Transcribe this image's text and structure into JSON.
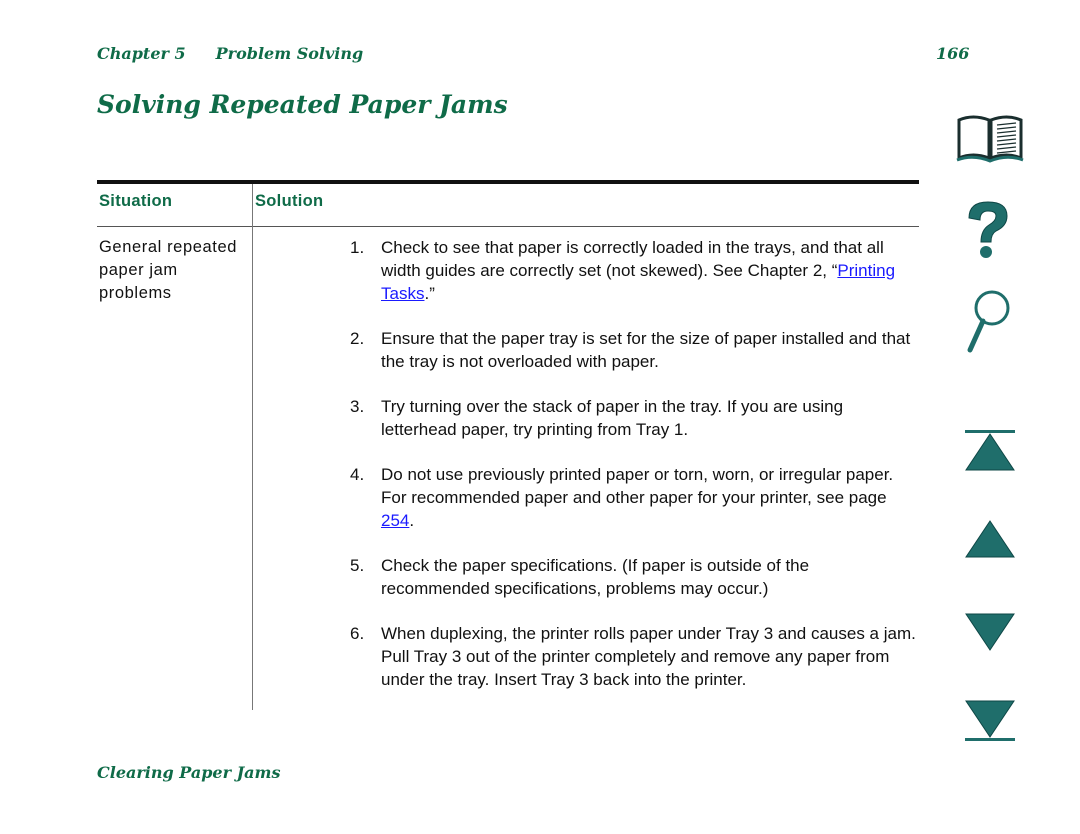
{
  "header": {
    "chapter": "Chapter 5",
    "section": "Problem Solving",
    "page_number": "166"
  },
  "title": "Solving Repeated Paper Jams",
  "table": {
    "columns": [
      "Situation",
      "Solution"
    ],
    "rows": [
      {
        "situation": "General repeated paper jam problems",
        "solutions": [
          {
            "num": "1.",
            "before": "Check to see that paper is correctly loaded in the trays, and that all width guides are correctly set (not skewed). See Chapter 2, “",
            "link": "Printing Tasks",
            "after": ".”"
          },
          {
            "num": "2.",
            "before": "Ensure that the paper tray is set for the size of paper installed and that the tray is not overloaded with paper.",
            "link": null,
            "after": ""
          },
          {
            "num": "3.",
            "before": "Try turning over the stack of paper in the tray. If you are using letterhead paper, try printing from Tray 1.",
            "link": null,
            "after": ""
          },
          {
            "num": "4.",
            "before": "Do not use previously printed paper or torn, worn, or irregular paper. For recommended paper and other paper for your printer, see page ",
            "link": "254",
            "after": "."
          },
          {
            "num": "5.",
            "before": "Check the paper specifications. (If paper is outside of the recommended specifications, problems may occur.)",
            "link": null,
            "after": ""
          },
          {
            "num": "6.",
            "before": "When duplexing, the printer rolls paper under Tray 3 and causes a jam. Pull Tray 3 out of the printer completely and remove any paper from under the tray. Insert Tray 3 back into the printer.",
            "link": null,
            "after": ""
          }
        ]
      }
    ]
  },
  "footer": "Clearing Paper Jams",
  "nav_icons": [
    "book-icon",
    "help-icon",
    "search-icon",
    "first-page-icon",
    "previous-page-icon",
    "next-page-icon",
    "last-page-icon"
  ],
  "colors": {
    "heading_green": "#0f6b48",
    "nav_teal": "#1f6e6b",
    "link_blue": "#1a1aff"
  }
}
